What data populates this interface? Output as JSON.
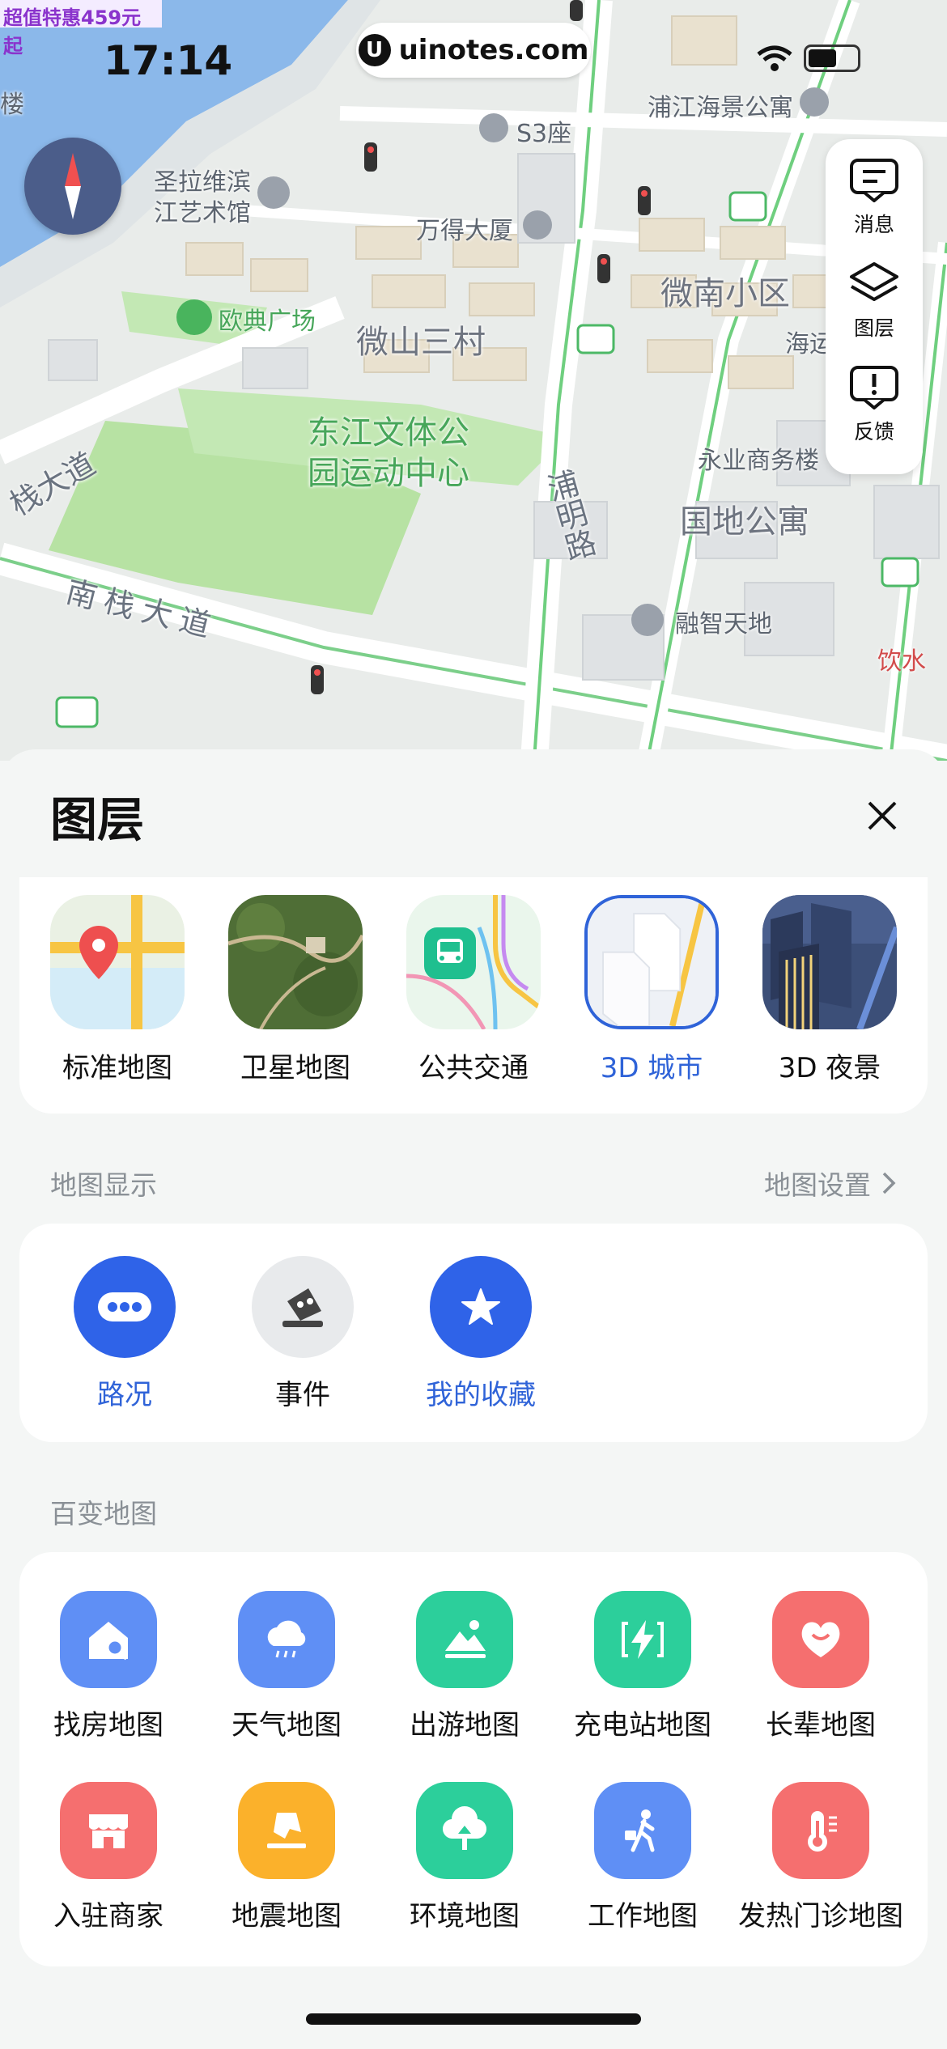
{
  "promo_banner": "超值特惠459元起",
  "status_bar": {
    "time": "17:14",
    "url": "uinotes.com"
  },
  "map": {
    "labels": {
      "poi_building": "楼",
      "s3": "S3座",
      "wande": "万得大厦",
      "pujiang": "浦江海景公寓",
      "shengla1": "圣拉维滨",
      "shengla2": "江艺术馆",
      "oudian": "欧典广场",
      "weishan": "微山三村",
      "weinan": "微南小区",
      "hai": "海运",
      "dongjiang1": "东江文体公",
      "dongjiang2": "园运动中心",
      "yongye": "永业商务楼",
      "guodi": "国地公寓",
      "rongzhi": "融智天地",
      "yinshui": "饮水",
      "nanzhan_top": "栈大道",
      "nanzhan": "南栈大道",
      "puming": "浦明路"
    },
    "side_panel": [
      {
        "icon": "message-icon",
        "label": "消息"
      },
      {
        "icon": "layers-icon",
        "label": "图层"
      },
      {
        "icon": "feedback-icon",
        "label": "反馈"
      }
    ]
  },
  "sheet": {
    "title": "图层",
    "layers": [
      {
        "label": "标准地图",
        "active": false
      },
      {
        "label": "卫星地图",
        "active": false
      },
      {
        "label": "公共交通",
        "active": false
      },
      {
        "label": "3D 城市",
        "active": true
      },
      {
        "label": "3D 夜景",
        "active": false
      }
    ],
    "display_section": {
      "title": "地图显示",
      "link": "地图设置"
    },
    "display_items": [
      {
        "label": "路况",
        "icon": "traffic-icon",
        "on": true
      },
      {
        "label": "事件",
        "icon": "event-icon",
        "on": false
      },
      {
        "label": "我的收藏",
        "icon": "star-icon",
        "on": true
      }
    ],
    "baibian_section": {
      "title": "百变地图"
    },
    "baibian_items": [
      {
        "label": "找房地图",
        "icon": "house-search-icon",
        "color": "#5f8ff5"
      },
      {
        "label": "天气地图",
        "icon": "weather-icon",
        "color": "#5f8ff5"
      },
      {
        "label": "出游地图",
        "icon": "travel-icon",
        "color": "#2ccf9b"
      },
      {
        "label": "充电站地图",
        "icon": "charging-icon",
        "color": "#2ccf9b"
      },
      {
        "label": "长辈地图",
        "icon": "heart-icon",
        "color": "#f56f6f"
      },
      {
        "label": "入驻商家",
        "icon": "shop-icon",
        "color": "#f56f6f"
      },
      {
        "label": "地震地图",
        "icon": "earthquake-icon",
        "color": "#fbb12b"
      },
      {
        "label": "环境地图",
        "icon": "environment-icon",
        "color": "#2ccf9b"
      },
      {
        "label": "工作地图",
        "icon": "work-icon",
        "color": "#5f8ff5"
      },
      {
        "label": "发热门诊地图",
        "icon": "thermometer-icon",
        "color": "#f56f6f"
      }
    ]
  }
}
